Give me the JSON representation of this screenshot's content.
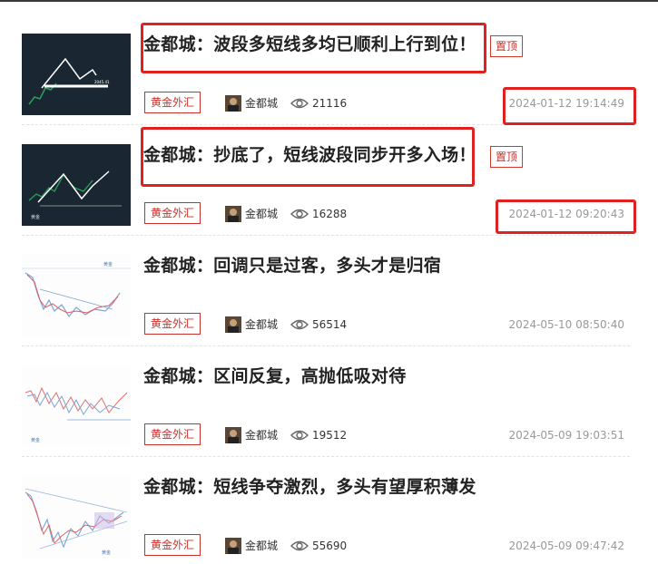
{
  "articles": [
    {
      "title": "金都城：波段多短线多均已顺利上行到位！",
      "pinned": true,
      "tag": "黄金外汇",
      "author": "金都城",
      "views": "21116",
      "date": "2024-01-12 19:14:49"
    },
    {
      "title": "金都城：抄底了，短线波段同步开多入场！",
      "pinned": true,
      "tag": "黄金外汇",
      "author": "金都城",
      "views": "16288",
      "date": "2024-01-12 09:20:43"
    },
    {
      "title": "金都城：回调只是过客，多头才是归宿",
      "pinned": false,
      "tag": "黄金外汇",
      "author": "金都城",
      "views": "56514",
      "date": "2024-05-10 08:50:40"
    },
    {
      "title": "金都城：区间反复，高抛低吸对待",
      "pinned": false,
      "tag": "黄金外汇",
      "author": "金都城",
      "views": "19512",
      "date": "2024-05-09 19:03:51"
    },
    {
      "title": "金都城：短线争夺激烈，多头有望厚积薄发",
      "pinned": false,
      "tag": "黄金外汇",
      "author": "金都城",
      "views": "55690",
      "date": "2024-05-09 09:47:42"
    }
  ],
  "pin_label": "置顶",
  "icons": {
    "views": "eye-icon",
    "avatar": "author-avatar"
  },
  "colors": {
    "tag_red": "#c9302c",
    "highlight_red": "#e12020",
    "date_gray": "#999999"
  }
}
